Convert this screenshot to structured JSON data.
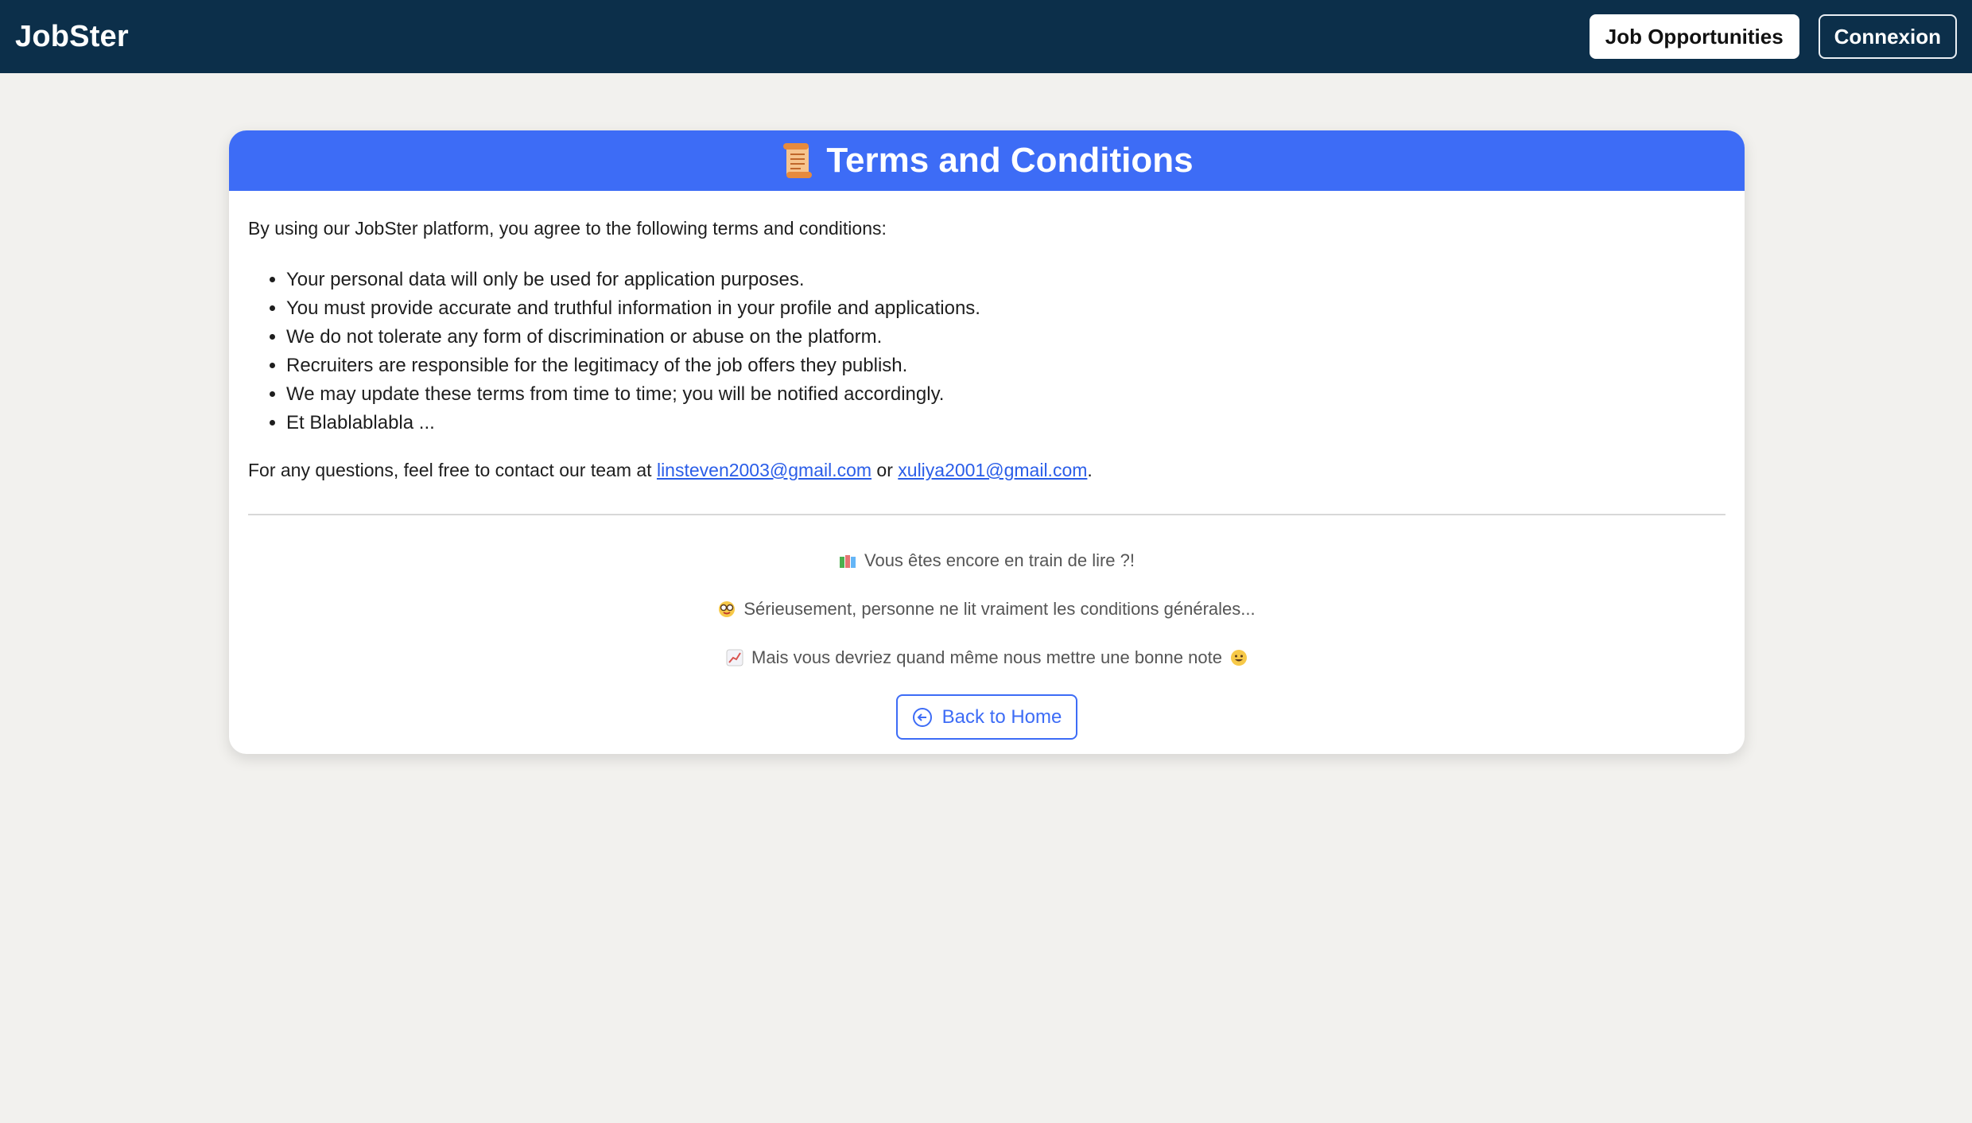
{
  "navbar": {
    "brand": "JobSter",
    "job_opportunities_label": "Job Opportunities",
    "login_label": "Connexion"
  },
  "card": {
    "header_icon": "scroll-icon",
    "title": "Terms and Conditions",
    "intro": "By using our JobSter platform, you agree to the following terms and conditions:",
    "terms": [
      "Your personal data will only be used for application purposes.",
      "You must provide accurate and truthful information in your profile and applications.",
      "We do not tolerate any form of discrimination or abuse on the platform.",
      "Recruiters are responsible for the legitimacy of the job offers they publish.",
      "We may update these terms from time to time; you will be notified accordingly.",
      "Et Blablablabla ..."
    ],
    "contact": {
      "prefix": "For any questions, feel free to contact our team at ",
      "email1": "linsteven2003@gmail.com",
      "separator": " or ",
      "email2": "xuliya2001@gmail.com",
      "suffix": "."
    },
    "notes": [
      {
        "icon": "books-icon",
        "text": "Vous êtes encore en train de lire ?!"
      },
      {
        "icon": "nerd-face-icon",
        "text": "Sérieusement, personne ne lit vraiment les conditions générales..."
      },
      {
        "icon": "chart-increasing-icon",
        "text": "Mais vous devriez quand même nous mettre une bonne note",
        "trailing_icon": "grinning-face-icon"
      }
    ],
    "back_button_label": "Back to Home",
    "back_button_icon": "arrow-left-circle-icon"
  },
  "colors": {
    "navbar_bg": "#0c2f4a",
    "header_bg": "#3d6cf6",
    "page_bg": "#f2f1ee",
    "link": "#2a5de8"
  }
}
